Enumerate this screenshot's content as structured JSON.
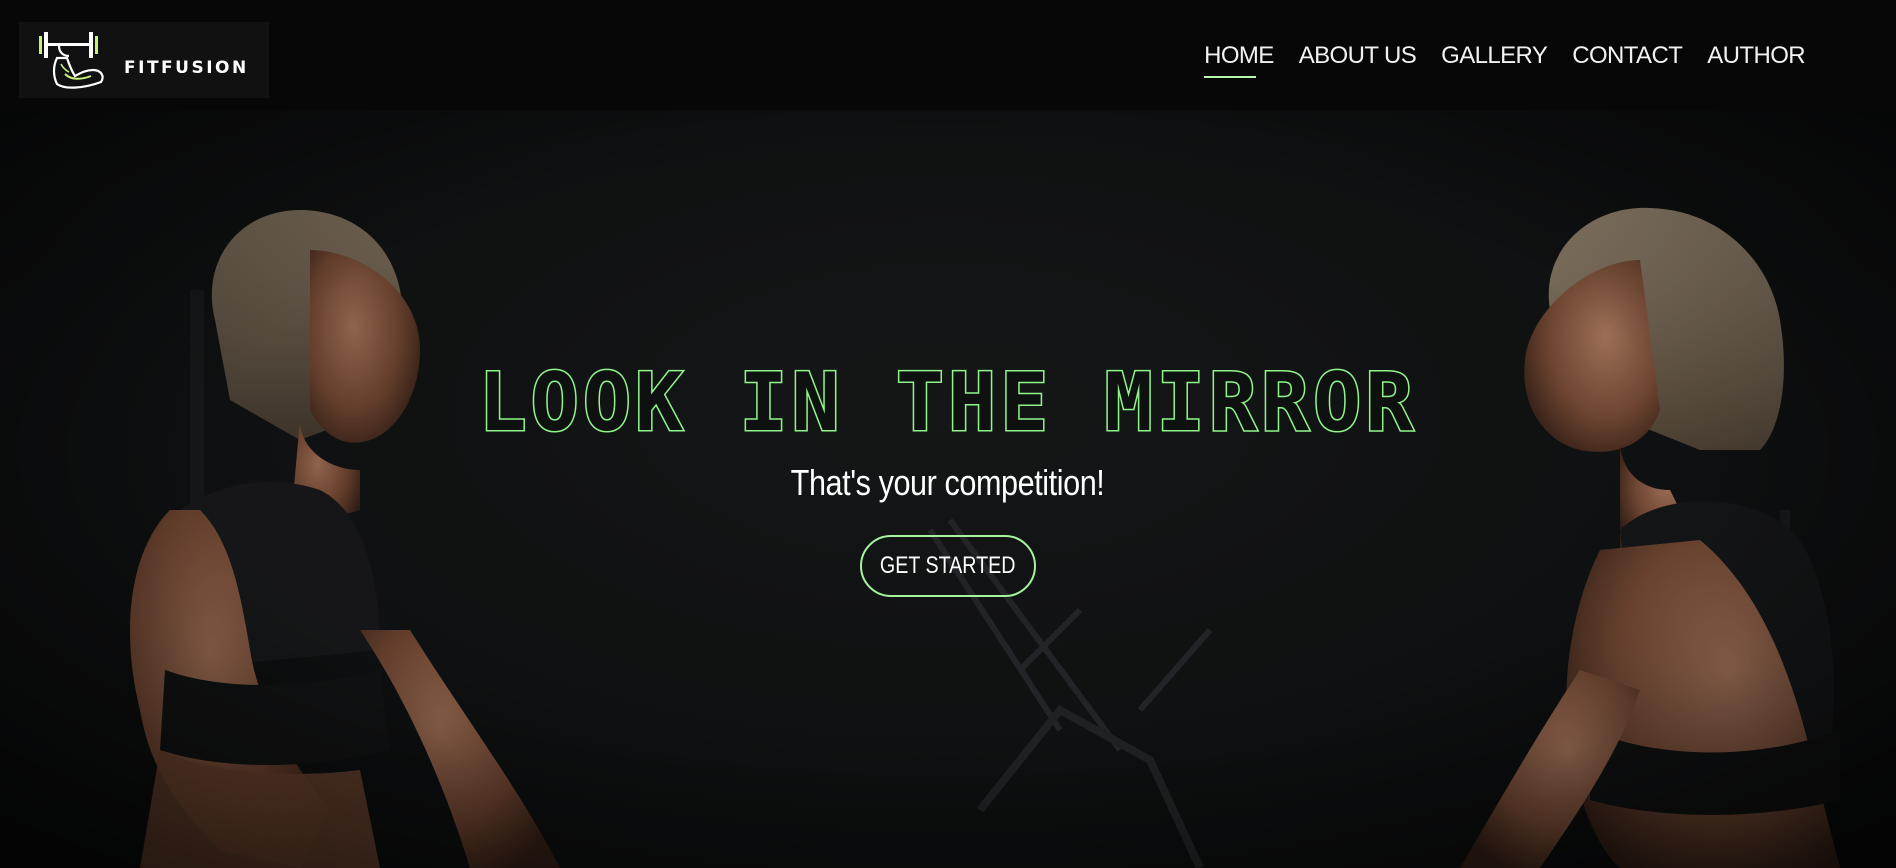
{
  "brand": {
    "name": "FITFUSION",
    "logo_icon": "flexed-arm-dumbbell-icon",
    "accent_color": "#8ff58a"
  },
  "nav": {
    "items": [
      {
        "label": "HOME",
        "active": true
      },
      {
        "label": "ABOUT US",
        "active": false
      },
      {
        "label": "GALLERY",
        "active": false
      },
      {
        "label": "CONTACT",
        "active": false
      },
      {
        "label": "AUTHOR",
        "active": false
      }
    ]
  },
  "hero": {
    "title": "LOOK IN THE MIRROR",
    "subtitle": "That's your competition!",
    "cta_label": "GET STARTED",
    "background_image": "two-women-gym-mirror-photo"
  }
}
